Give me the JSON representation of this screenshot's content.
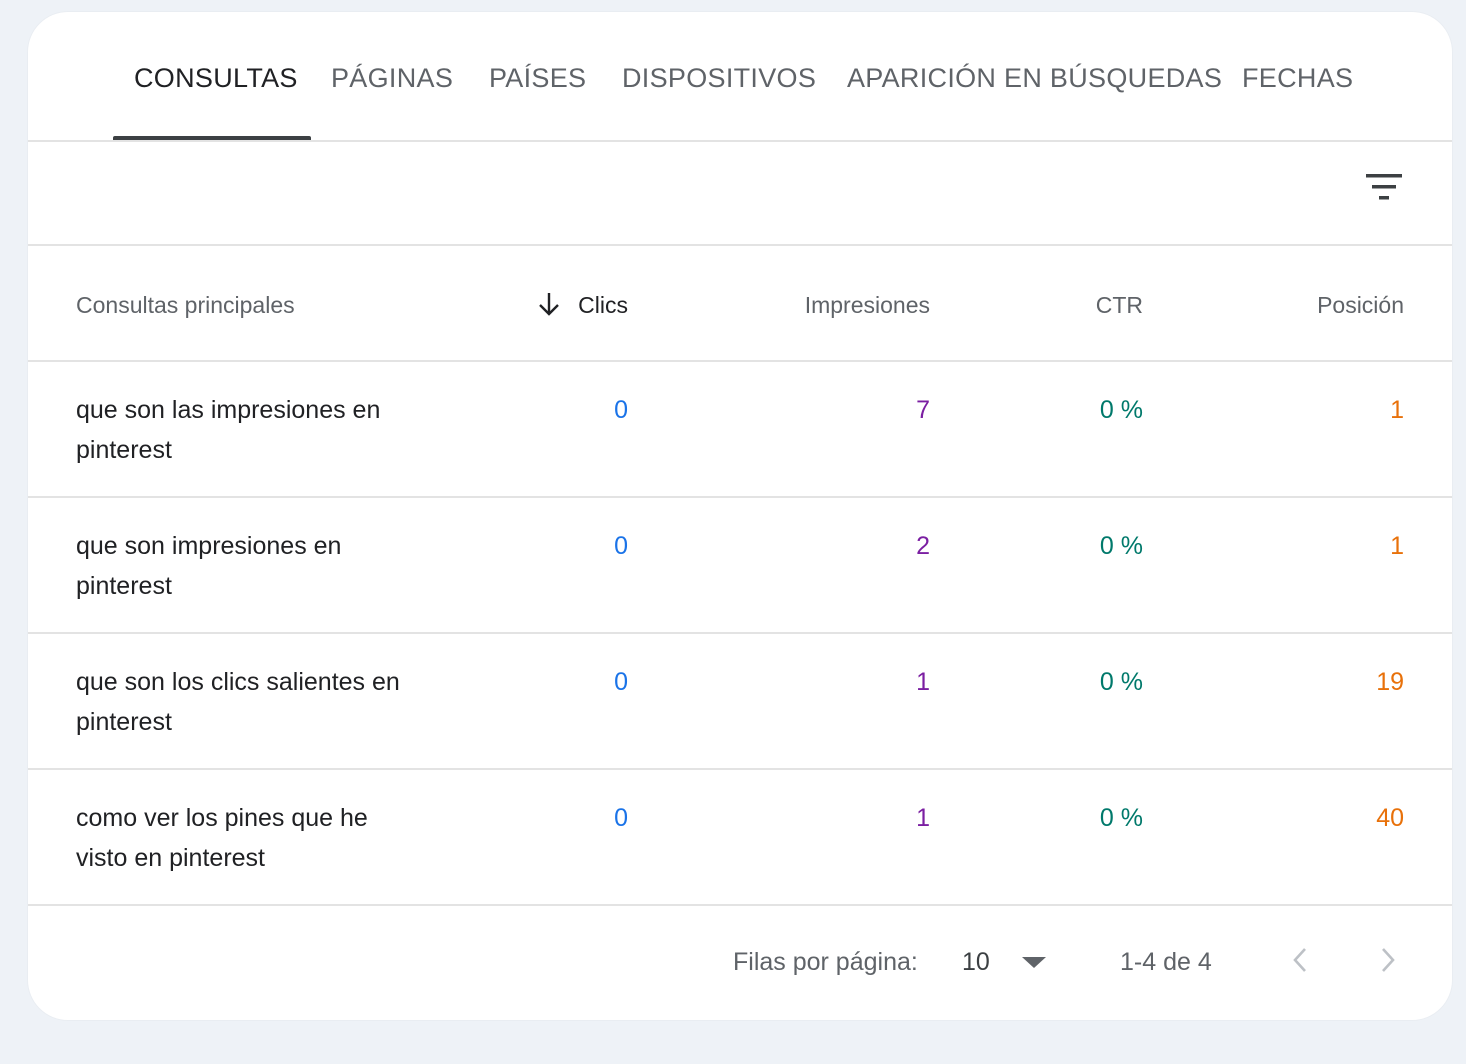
{
  "tabs": [
    {
      "label": "CONSULTAS",
      "active": true
    },
    {
      "label": "PÁGINAS",
      "active": false
    },
    {
      "label": "PAÍSES",
      "active": false
    },
    {
      "label": "DISPOSITIVOS",
      "active": false
    },
    {
      "label": "APARICIÓN EN BÚSQUEDAS",
      "active": false
    },
    {
      "label": "FECHAS",
      "active": false
    }
  ],
  "filter": {
    "icon": "filter-list-icon"
  },
  "table": {
    "headers": {
      "query": "Consultas principales",
      "clicks": "Clics",
      "impressions": "Impresiones",
      "ctr": "CTR",
      "position": "Posición"
    },
    "sort": {
      "column": "clicks",
      "direction": "desc",
      "icon": "arrow-downward-icon"
    },
    "rows": [
      {
        "query": "que son las impresiones en pinterest",
        "clicks": "0",
        "impressions": "7",
        "ctr": "0 %",
        "position": "1"
      },
      {
        "query": "que son impresiones en pinterest",
        "clicks": "0",
        "impressions": "2",
        "ctr": "0 %",
        "position": "1"
      },
      {
        "query": "que son los clics salientes en pinterest",
        "clicks": "0",
        "impressions": "1",
        "ctr": "0 %",
        "position": "19"
      },
      {
        "query": "como ver los pines que he visto en pinterest",
        "clicks": "0",
        "impressions": "1",
        "ctr": "0 %",
        "position": "40"
      }
    ]
  },
  "pagination": {
    "rows_per_page_label": "Filas por página:",
    "rows_per_page": "10",
    "range": "1-4 de 4",
    "prev_icon": "chevron-left-icon",
    "next_icon": "chevron-right-icon"
  },
  "colors": {
    "clicks": "#1a73e8",
    "impressions": "#7b1fa2",
    "ctr": "#00796b",
    "position": "#e8710a"
  }
}
